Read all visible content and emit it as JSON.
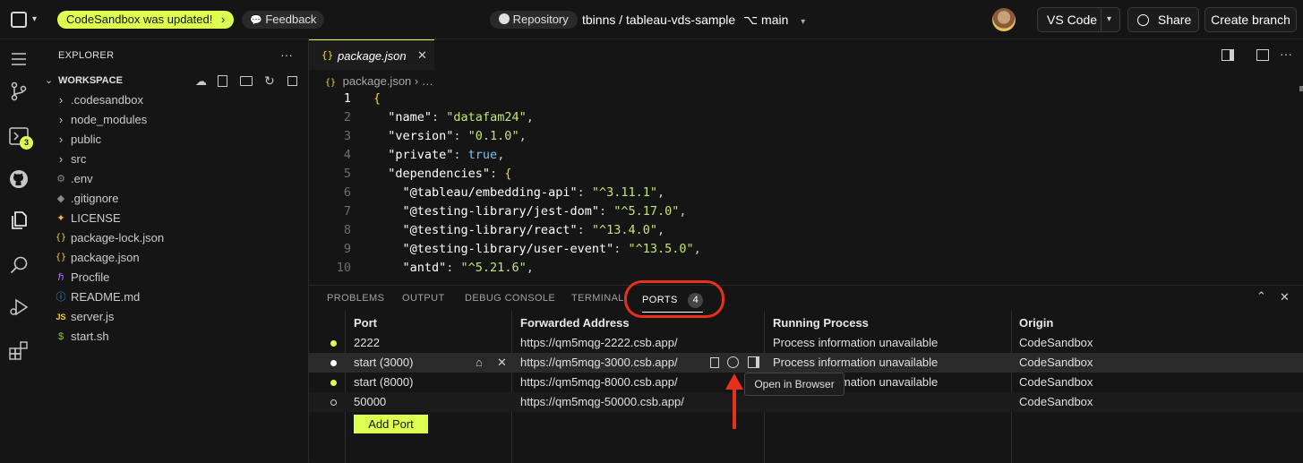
{
  "topbar": {
    "updated_badge": "CodeSandbox was updated!",
    "feedback": "Feedback",
    "repository": "Repository",
    "repo_path": "tbinns / tableau-vds-sample",
    "branch": "main",
    "vscode": "VS Code",
    "share": "Share",
    "create_branch": "Create branch"
  },
  "activity": {
    "badge": "3"
  },
  "explorer": {
    "title": "EXPLORER",
    "more": "···",
    "workspace": "WORKSPACE",
    "items": [
      {
        "label": ".codesandbox",
        "icon": "chevron-right"
      },
      {
        "label": "node_modules",
        "icon": "chevron-right"
      },
      {
        "label": "public",
        "icon": "chevron-right"
      },
      {
        "label": "src",
        "icon": "chevron-right"
      },
      {
        "label": ".env",
        "icon": "gear"
      },
      {
        "label": ".gitignore",
        "icon": "gitignore"
      },
      {
        "label": "LICENSE",
        "icon": "license"
      },
      {
        "label": "package-lock.json",
        "icon": "json"
      },
      {
        "label": "package.json",
        "icon": "json"
      },
      {
        "label": "Procfile",
        "icon": "heroku"
      },
      {
        "label": "README.md",
        "icon": "info"
      },
      {
        "label": "server.js",
        "icon": "js"
      },
      {
        "label": "start.sh",
        "icon": "shell"
      }
    ]
  },
  "editor": {
    "tab_label": "package.json",
    "breadcrumb_file": "package.json",
    "breadcrumb_more": "…",
    "lines": [
      {
        "n": "1",
        "parts": [
          {
            "t": "{",
            "c": "b"
          }
        ]
      },
      {
        "n": "2",
        "parts": [
          {
            "t": "  \"name\"",
            "c": "k"
          },
          {
            "t": ": ",
            "c": "p"
          },
          {
            "t": "\"datafam24\"",
            "c": "s"
          },
          {
            "t": ",",
            "c": "p"
          }
        ]
      },
      {
        "n": "3",
        "parts": [
          {
            "t": "  \"version\"",
            "c": "k"
          },
          {
            "t": ": ",
            "c": "p"
          },
          {
            "t": "\"0.1.0\"",
            "c": "s"
          },
          {
            "t": ",",
            "c": "p"
          }
        ]
      },
      {
        "n": "4",
        "parts": [
          {
            "t": "  \"private\"",
            "c": "k"
          },
          {
            "t": ": ",
            "c": "p"
          },
          {
            "t": "true",
            "c": "t"
          },
          {
            "t": ",",
            "c": "p"
          }
        ]
      },
      {
        "n": "5",
        "parts": [
          {
            "t": "  \"dependencies\"",
            "c": "k"
          },
          {
            "t": ": ",
            "c": "p"
          },
          {
            "t": "{",
            "c": "b"
          }
        ]
      },
      {
        "n": "6",
        "parts": [
          {
            "t": "    \"@tableau/embedding-api\"",
            "c": "k"
          },
          {
            "t": ": ",
            "c": "p"
          },
          {
            "t": "\"^3.11.1\"",
            "c": "s"
          },
          {
            "t": ",",
            "c": "p"
          }
        ]
      },
      {
        "n": "7",
        "parts": [
          {
            "t": "    \"@testing-library/jest-dom\"",
            "c": "k"
          },
          {
            "t": ": ",
            "c": "p"
          },
          {
            "t": "\"^5.17.0\"",
            "c": "s"
          },
          {
            "t": ",",
            "c": "p"
          }
        ]
      },
      {
        "n": "8",
        "parts": [
          {
            "t": "    \"@testing-library/react\"",
            "c": "k"
          },
          {
            "t": ": ",
            "c": "p"
          },
          {
            "t": "\"^13.4.0\"",
            "c": "s"
          },
          {
            "t": ",",
            "c": "p"
          }
        ]
      },
      {
        "n": "9",
        "parts": [
          {
            "t": "    \"@testing-library/user-event\"",
            "c": "k"
          },
          {
            "t": ": ",
            "c": "p"
          },
          {
            "t": "\"^13.5.0\"",
            "c": "s"
          },
          {
            "t": ",",
            "c": "p"
          }
        ]
      },
      {
        "n": "10",
        "parts": [
          {
            "t": "    \"antd\"",
            "c": "k"
          },
          {
            "t": ": ",
            "c": "p"
          },
          {
            "t": "\"^5.21.6\"",
            "c": "s"
          },
          {
            "t": ",",
            "c": "p"
          }
        ]
      }
    ]
  },
  "panel": {
    "tabs": [
      "PROBLEMS",
      "OUTPUT",
      "DEBUG CONSOLE",
      "TERMINAL",
      "PORTS"
    ],
    "ports_count": "4",
    "headers": [
      "Port",
      "Forwarded Address",
      "Running Process",
      "Origin"
    ],
    "rows": [
      {
        "port": "2222",
        "address": "https://qm5mqg-2222.csb.app/",
        "process": "Process information unavailable",
        "origin": "CodeSandbox",
        "status": "active"
      },
      {
        "port": "start (3000)",
        "address": "https://qm5mqg-3000.csb.app/",
        "process": "Process information unavailable",
        "origin": "CodeSandbox",
        "status": "selected"
      },
      {
        "port": "start (8000)",
        "address": "https://qm5mqg-8000.csb.app/",
        "process": "Process information unavailable",
        "origin": "CodeSandbox",
        "status": "active"
      },
      {
        "port": "50000",
        "address": "https://qm5mqg-50000.csb.app/",
        "process": "",
        "origin": "CodeSandbox",
        "status": "inactive"
      }
    ],
    "add_port": "Add Port",
    "tooltip": "Open in Browser"
  },
  "colors": {
    "accent": "#dcff50",
    "annotation": "#e8301c"
  }
}
